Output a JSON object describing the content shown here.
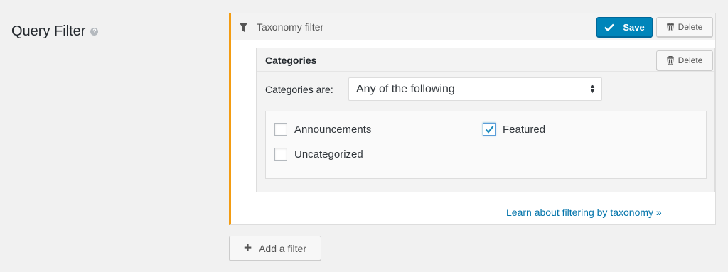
{
  "field": {
    "label": "Query Filter",
    "help_icon": "help-icon"
  },
  "filter": {
    "title": "Taxonomy filter",
    "icon": "filter-icon",
    "save_label": "Save",
    "delete_label": "Delete",
    "accent_color": "#f39c12"
  },
  "categories": {
    "title": "Categories",
    "delete_label": "Delete",
    "are_label": "Categories are:",
    "select_value": "Any of the following",
    "options": [
      {
        "label": "Announcements",
        "checked": false
      },
      {
        "label": "Featured",
        "checked": true
      },
      {
        "label": "Uncategorized",
        "checked": false
      }
    ]
  },
  "learn_link": "Learn about filtering by taxonomy »",
  "add_filter_label": "Add a filter",
  "colors": {
    "primary": "#0085ba",
    "link": "#0073aa"
  }
}
